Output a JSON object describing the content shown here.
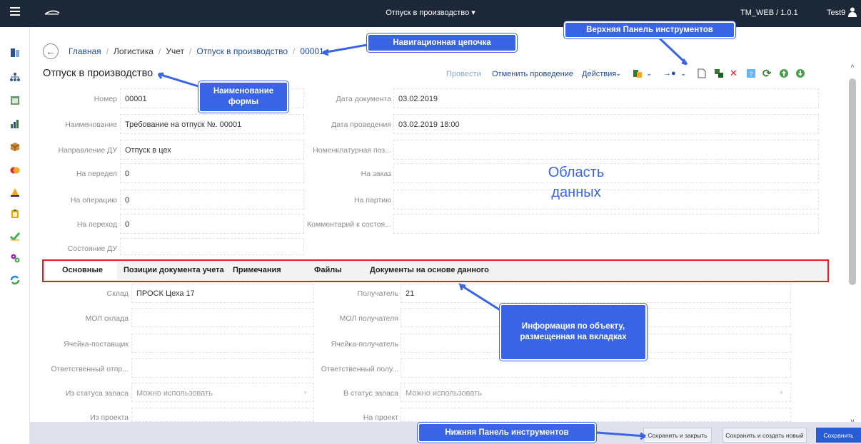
{
  "topbar": {
    "title": "Отпуск в производство ▾",
    "version": "TM_WEB / 1.0.1",
    "user": "Test9"
  },
  "breadcrumb": {
    "items": [
      "Главная",
      "Логистика",
      "Учет",
      "Отпуск в производство",
      "00001"
    ],
    "separator": "/"
  },
  "form_title": "Отпуск в производство",
  "toolbar": {
    "post": "Провести",
    "unpost": "Отменить проведение",
    "actions": "Действия"
  },
  "fields": {
    "number_label": "Номер",
    "number_value": "00001",
    "name_label": "Наименование",
    "name_value": "Требование на отпуск №. 00001",
    "direction_label": "Направление ДУ",
    "direction_value": "Отпуск в цех",
    "redo_label": "На передел",
    "redo_value": "0",
    "operation_label": "На операцию",
    "operation_value": "0",
    "transfer_label": "На переход",
    "transfer_value": "0",
    "state_label": "Состояние ДУ",
    "doc_date_label": "Дата документа",
    "doc_date_value": "03.02.2019",
    "post_date_label": "Дата проведения",
    "post_date_value": "03.02.2019 18:00",
    "nomen_label": "Номенклатурная поз...",
    "order_label": "На заказ",
    "batch_label": "На партию",
    "comment_label": "Комментарий к состоя..."
  },
  "tabs": [
    "Основные",
    "Позиции документа учета",
    "Примечания",
    "Файлы",
    "Документы на основе данного"
  ],
  "tab_fields": {
    "warehouse_label": "Склад",
    "warehouse_value": "ПРОСК Цеха 17",
    "mol_wh_label": "МОЛ склада",
    "cell_sup_label": "Ячейка-поставщик",
    "resp_send_label": "Ответственный отпр...",
    "from_status_label": "Из статуса запаса",
    "from_status_value": "Можно использовать",
    "from_project_label": "Из проекта",
    "receiver_label": "Получатель",
    "receiver_value": "21",
    "mol_rcv_label": "МОЛ получателя",
    "cell_rcv_label": "Ячейка-получатель",
    "resp_rcv_label": "Ответственный полу...",
    "to_status_label": "В статус запаса",
    "to_status_value": "Можно использовать",
    "to_project_label": "На проект"
  },
  "bottom": {
    "save_close": "Сохранить и закрыть",
    "save_new": "Сохранить и создать новый",
    "save": "Сохранить"
  },
  "annotations": {
    "top_toolbar": "Верхняя Панель инструментов",
    "nav_chain": "Навигационная цепочка",
    "form_name": "Наименование формы",
    "data_area_1": "Область",
    "data_area_2": "данных",
    "tabs_info": "Информация по объекту, размещенная на вкладках",
    "bottom_toolbar": "Нижняя Панель инструментов"
  },
  "colors": {
    "topbar": "#1c2738",
    "link": "#1e4aa8",
    "callout": "#3a64e6",
    "tab_border": "#e21f26",
    "primary_button": "#2a5bd7"
  }
}
